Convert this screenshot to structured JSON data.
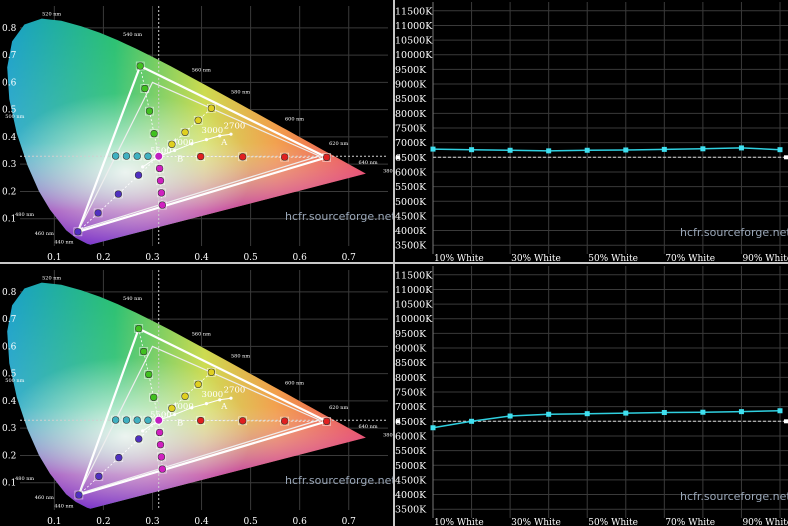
{
  "watermark": "hcfr.sourceforge.net",
  "chart_data": [
    {
      "type": "scatter",
      "id": "cie_top",
      "x_ticks": [
        "0.1",
        "0.2",
        "0.3",
        "0.4",
        "0.5",
        "0.6",
        "0.7"
      ],
      "y_ticks": [
        "0.1",
        "0.2",
        "0.3",
        "0.4",
        "0.5",
        "0.6",
        "0.7",
        "0.8"
      ],
      "xlim": [
        0.03,
        0.78
      ],
      "ylim": [
        0.0,
        0.88
      ],
      "reference_x": 0.3127,
      "reference_y": 0.329,
      "locus_labels": [
        "520 nm",
        "540 nm",
        "560 nm",
        "580 nm",
        "600 nm",
        "620 nm",
        "640 nm",
        "500 nm",
        "480 nm",
        "460 nm",
        "440 nm",
        "380 nm"
      ],
      "cct_labels": [
        "5500",
        "4000",
        "3000",
        "2700",
        "A",
        "B"
      ],
      "gamut_reference": [
        [
          0.64,
          0.33
        ],
        [
          0.3,
          0.6
        ],
        [
          0.15,
          0.06
        ]
      ],
      "gamut_measured": [
        [
          0.655,
          0.325
        ],
        [
          0.275,
          0.66
        ],
        [
          0.148,
          0.052
        ]
      ]
    },
    {
      "type": "line",
      "id": "cct_top",
      "y_ticks": [
        "11500K",
        "11000K",
        "10500K",
        "10000K",
        "9500K",
        "9000K",
        "8500K",
        "8000K",
        "7500K",
        "7000K",
        "6500K",
        "6000K",
        "5500K",
        "5000K",
        "4500K",
        "4000K",
        "3500K"
      ],
      "x_ticks": [
        "10% White",
        "30% White",
        "50% White",
        "70% White",
        "90% White"
      ],
      "ylim": [
        3200,
        11800
      ],
      "reference": 6500,
      "x": [
        10,
        20,
        30,
        40,
        50,
        60,
        70,
        80,
        90,
        100
      ],
      "values": [
        6780,
        6760,
        6740,
        6720,
        6740,
        6750,
        6770,
        6790,
        6820,
        6760
      ]
    },
    {
      "type": "scatter",
      "id": "cie_bottom",
      "x_ticks": [
        "0.1",
        "0.2",
        "0.3",
        "0.4",
        "0.5",
        "0.6",
        "0.7"
      ],
      "y_ticks": [
        "0.1",
        "0.2",
        "0.3",
        "0.4",
        "0.5",
        "0.6",
        "0.7",
        "0.8"
      ],
      "xlim": [
        0.03,
        0.78
      ],
      "ylim": [
        0.0,
        0.88
      ],
      "reference_x": 0.3127,
      "reference_y": 0.329,
      "locus_labels": [
        "520 nm",
        "540 nm",
        "560 nm",
        "580 nm",
        "600 nm",
        "620 nm",
        "640 nm",
        "500 nm",
        "480 nm",
        "460 nm",
        "440 nm",
        "380 nm"
      ],
      "cct_labels": [
        "5500",
        "4000",
        "3000",
        "2700",
        "A",
        "B"
      ],
      "gamut_reference": [
        [
          0.64,
          0.33
        ],
        [
          0.3,
          0.6
        ],
        [
          0.15,
          0.06
        ]
      ],
      "gamut_measured": [
        [
          0.655,
          0.325
        ],
        [
          0.272,
          0.665
        ],
        [
          0.15,
          0.055
        ]
      ]
    },
    {
      "type": "line",
      "id": "cct_bottom",
      "y_ticks": [
        "11500K",
        "11000K",
        "10500K",
        "10000K",
        "9500K",
        "9000K",
        "8500K",
        "8000K",
        "7500K",
        "7000K",
        "6500K",
        "6000K",
        "5500K",
        "5000K",
        "4500K",
        "4000K",
        "3500K"
      ],
      "x_ticks": [
        "10% White",
        "30% White",
        "50% White",
        "70% White",
        "90% White"
      ],
      "ylim": [
        3200,
        11800
      ],
      "reference": 6500,
      "x": [
        10,
        20,
        30,
        40,
        50,
        60,
        70,
        80,
        90,
        100
      ],
      "values": [
        6280,
        6500,
        6680,
        6740,
        6760,
        6780,
        6800,
        6810,
        6830,
        6860
      ]
    }
  ]
}
